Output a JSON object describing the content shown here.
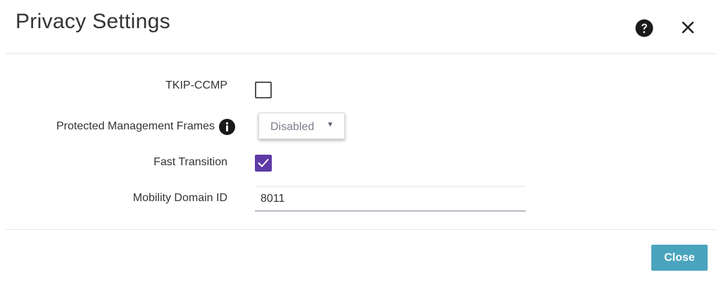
{
  "dialog": {
    "title": "Privacy Settings",
    "help_icon": "question-circle-icon",
    "close_icon": "close-x-icon"
  },
  "form": {
    "tkip_ccmp": {
      "label": "TKIP-CCMP",
      "checked": false
    },
    "protected_management_frames": {
      "label": "Protected Management Frames",
      "info_icon": "info-circle-icon",
      "selected": "Disabled",
      "caret": "▼"
    },
    "fast_transition": {
      "label": "Fast Transition",
      "checked": true
    },
    "mobility_domain_id": {
      "label": "Mobility Domain ID",
      "value": "8011"
    }
  },
  "footer": {
    "close_label": "Close"
  },
  "colors": {
    "accent_purple": "#5e3aa6",
    "close_button": "#4aa4bd",
    "icon_dark": "#1a1a1a"
  }
}
